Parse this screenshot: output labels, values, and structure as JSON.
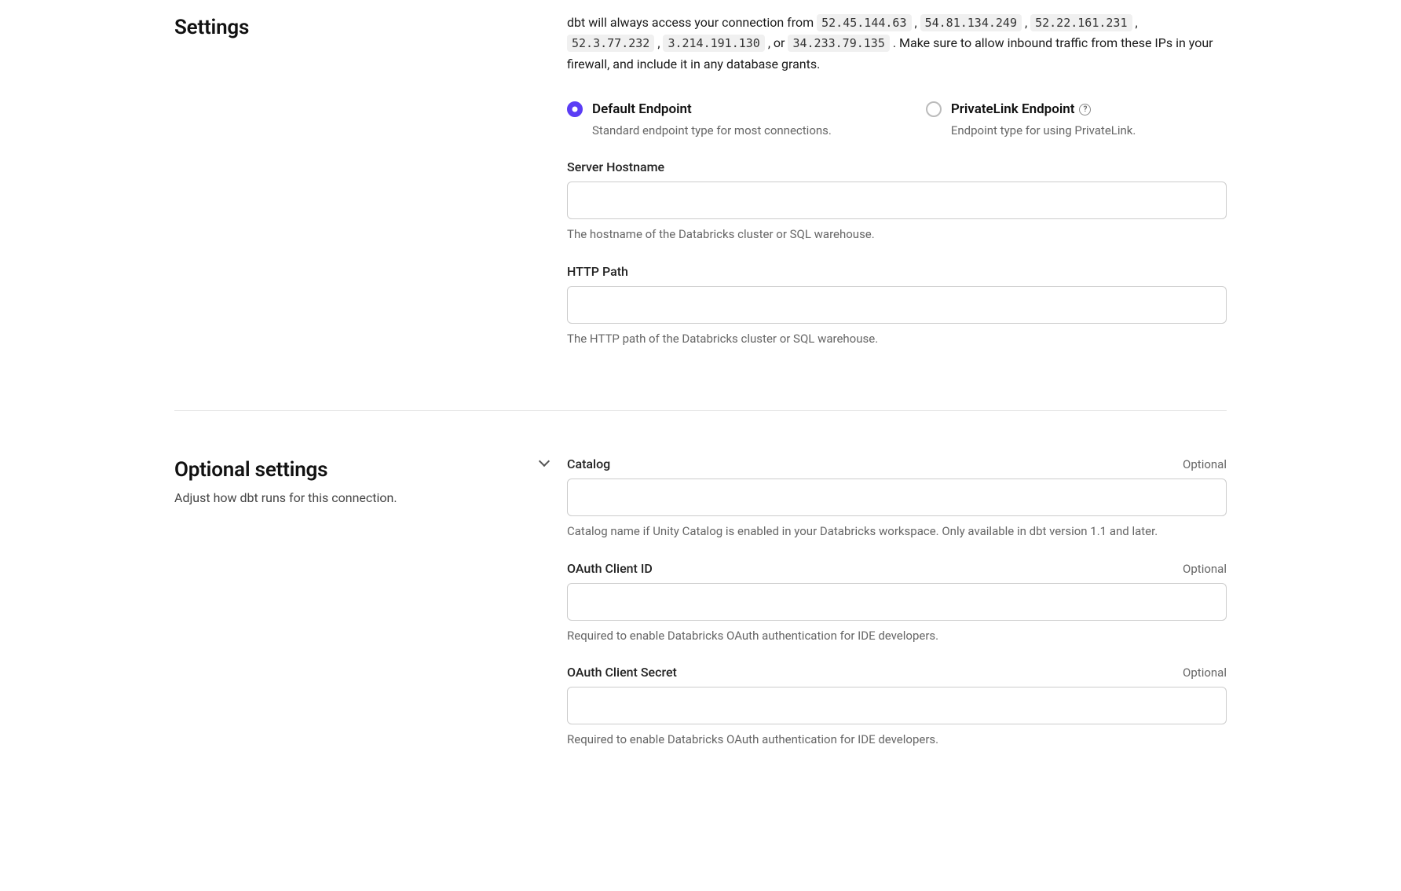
{
  "settings": {
    "title": "Settings",
    "intro": {
      "prefix": "dbt will always access your connection from ",
      "ips": [
        "52.45.144.63",
        "54.81.134.249",
        "52.22.161.231",
        "52.3.77.232",
        "3.214.191.130"
      ],
      "sep_comma": " , ",
      "sep_or": " , or ",
      "last_ip": "34.233.79.135",
      "suffix": " . Make sure to allow inbound traffic from these IPs in your firewall, and include it in any database grants."
    },
    "endpoint": {
      "default": {
        "title": "Default Endpoint",
        "desc": "Standard endpoint type for most connections.",
        "selected": true
      },
      "privatelink": {
        "title": "PrivateLink Endpoint",
        "desc": "Endpoint type for using PrivateLink.",
        "selected": false
      }
    },
    "fields": {
      "hostname": {
        "label": "Server Hostname",
        "value": "",
        "help": "The hostname of the Databricks cluster or SQL warehouse."
      },
      "httppath": {
        "label": "HTTP Path",
        "value": "",
        "help": "The HTTP path of the Databricks cluster or SQL warehouse."
      }
    }
  },
  "optional": {
    "title": "Optional settings",
    "subtitle": "Adjust how dbt runs for this connection.",
    "optional_label": "Optional",
    "fields": {
      "catalog": {
        "label": "Catalog",
        "value": "",
        "help": "Catalog name if Unity Catalog is enabled in your Databricks workspace. Only available in dbt version 1.1 and later."
      },
      "oauth_id": {
        "label": "OAuth Client ID",
        "value": "",
        "help": "Required to enable Databricks OAuth authentication for IDE developers."
      },
      "oauth_secret": {
        "label": "OAuth Client Secret",
        "value": "",
        "help": "Required to enable Databricks OAuth authentication for IDE developers."
      }
    }
  }
}
